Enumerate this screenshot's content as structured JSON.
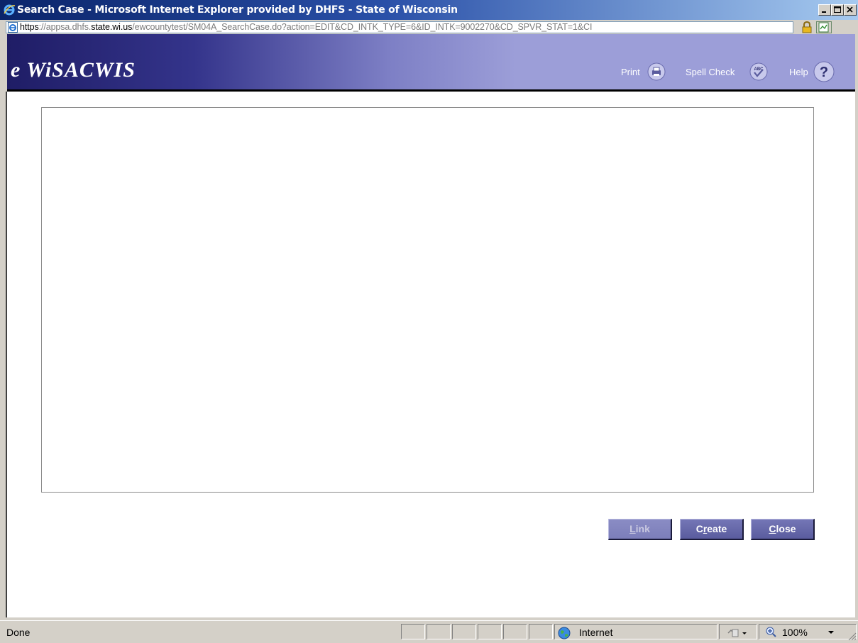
{
  "window": {
    "title": "Search Case - Microsoft Internet Explorer provided by DHFS - State of Wisconsin"
  },
  "address": {
    "scheme": "https",
    "sep": "://appsa.dhfs.",
    "host": "state.wi.us",
    "path": "/ewcountytest/SM04A_SearchCase.do?action=EDIT&CD_INTK_TYPE=6&ID_INTK=9002270&CD_SPVR_STAT=1&CI"
  },
  "header": {
    "logo": "e WiSACWIS",
    "print_label": "Print",
    "spell_label": "Spell Check",
    "help_label": "Help",
    "accent": "#9c9ed8"
  },
  "actions": {
    "link_first": "L",
    "link_rest": "ink",
    "create_first": "C",
    "create_u": "r",
    "create_rest": "eate",
    "close_first": "C",
    "close_rest": "lose"
  },
  "status": {
    "text": "Done",
    "zone": "Internet",
    "zoom": "100%"
  }
}
